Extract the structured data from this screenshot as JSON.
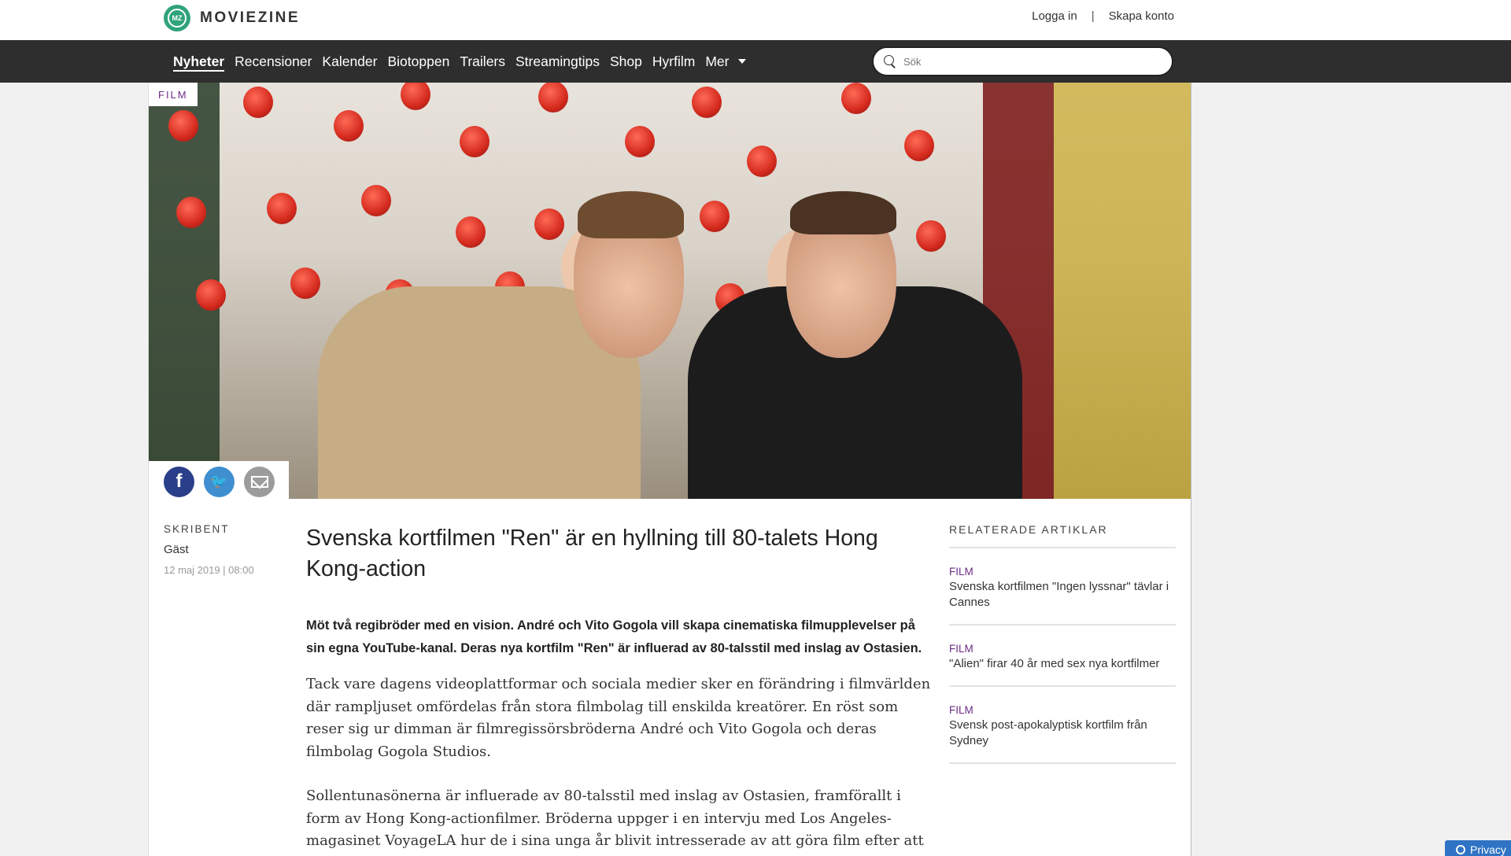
{
  "header": {
    "logo_badge": "MZ",
    "logo_text": "MOVIEZINE",
    "login": "Logga in",
    "separator": "|",
    "signup": "Skapa konto"
  },
  "nav": {
    "items": [
      "Nyheter",
      "Recensioner",
      "Kalender",
      "Biotoppen",
      "Trailers",
      "Streamingtips",
      "Shop",
      "Hyrfilm",
      "Mer"
    ],
    "active": "Nyheter",
    "search_placeholder": "Sök"
  },
  "hero": {
    "category": "FILM"
  },
  "share": {
    "icons": [
      "facebook-icon",
      "twitter-icon",
      "mail-icon"
    ]
  },
  "author": {
    "label": "SKRIBENT",
    "name": "Gäst",
    "date": "12 maj 2019 | 08:00"
  },
  "article": {
    "title": "Svenska kortfilmen \"Ren\" är en hyllning till 80-talets Hong Kong-action",
    "lead": "Möt två regibröder med en vision. André och Vito Gogola vill skapa cinematiska filmupplevelser på sin egna YouTube-kanal. Deras nya kortfilm \"Ren\" är influerad av 80-talsstil med inslag av Ostasien.",
    "paragraphs": [
      "Tack vare dagens videoplattformar och sociala medier sker en förändring i filmvärlden där rampljuset omfördelas från stora filmbolag till enskilda kreatörer. En röst som reser sig ur dimman är filmregissörsbröderna André och Vito Gogola och deras filmbolag Gogola Studios.",
      "Sollentunasönerna är influerade av 80-talsstil med inslag av Ostasien, framförallt i form av Hong Kong-actionfilmer. Bröderna uppger i en intervju med Los Angeles-magasinet VoyageLA hur de i sina unga år blivit intresserade av att göra film efter att ha sett \"Toy"
    ]
  },
  "related": {
    "heading": "RELATERADE ARTIKLAR",
    "items": [
      {
        "category": "FILM",
        "title": "Svenska kortfilmen \"Ingen lyssnar\" tävlar i Cannes"
      },
      {
        "category": "FILM",
        "title": "\"Alien\" firar 40 år med sex nya kortfilmer"
      },
      {
        "category": "FILM",
        "title": "Svensk post-apokalyptisk kortfilm från Sydney"
      }
    ]
  },
  "privacy": {
    "label": "Privacy"
  },
  "colors": {
    "accent_purple": "#6b2d84",
    "nav_bg": "#2e2e2e",
    "logo_green": "#2fa37a",
    "facebook": "#2a3f8a",
    "twitter": "#3f8fd0"
  }
}
